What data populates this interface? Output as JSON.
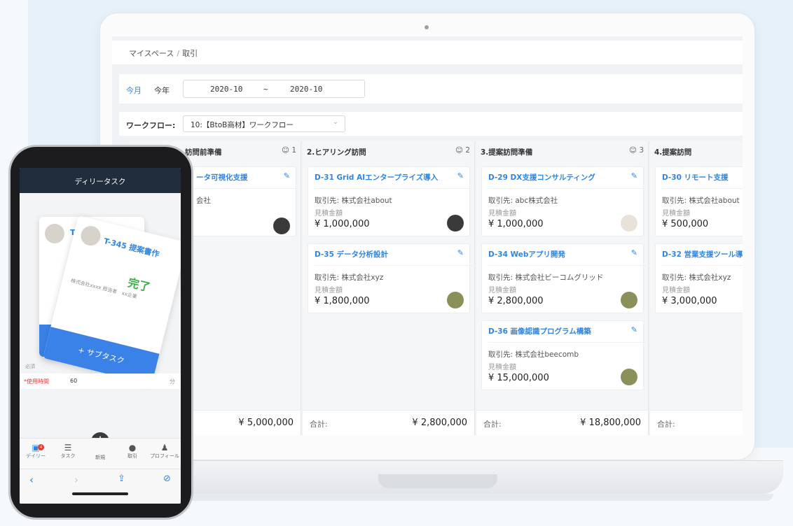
{
  "laptop": {
    "breadcrumb": {
      "root": "マイスペース",
      "separator": "/",
      "current": "取引"
    },
    "period": {
      "tab_month": "今月",
      "tab_year": "今年",
      "from": "2020-10",
      "tilde": "~",
      "to": "2020-10"
    },
    "workflow": {
      "label": "ワークフロー:",
      "selected": "10:【BtoB商材】ワークフロー"
    },
    "columns": [
      {
        "title": "訪問前準備",
        "count": "1",
        "cards": [
          {
            "title": "ータ可視化支援",
            "client": "会社",
            "amount_label": "",
            "amount": ""
          }
        ],
        "total_label": "",
        "total": "¥ 5,000,000"
      },
      {
        "title": "2.ヒアリング訪問",
        "count": "2",
        "cards": [
          {
            "title": "D-31 Grid AIエンタープライズ導入",
            "client": "取引先: 株式会社about",
            "amount_label": "見積金額",
            "amount": "¥ 1,000,000"
          },
          {
            "title": "D-35 データ分析設計",
            "client": "取引先: 株式会社xyz",
            "amount_label": "見積金額",
            "amount": "¥ 1,800,000"
          }
        ],
        "total_label": "合計:",
        "total": "¥ 2,800,000"
      },
      {
        "title": "3.提案訪問準備",
        "count": "3",
        "cards": [
          {
            "title": "D-29 DX支援コンサルティング",
            "client": "取引先: abc株式会社",
            "amount_label": "見積金額",
            "amount": "¥ 1,000,000"
          },
          {
            "title": "D-34 Webアプリ開発",
            "client": "取引先: 株式会社ビーコムグリッド",
            "amount_label": "見積金額",
            "amount": "¥ 2,800,000"
          },
          {
            "title": "D-36 画像認識プログラム構築",
            "client": "取引先: 株式会社beecomb",
            "amount_label": "見積金額",
            "amount": "¥ 15,000,000"
          }
        ],
        "total_label": "合計:",
        "total": "¥ 18,800,000"
      },
      {
        "title": "4.提案訪問",
        "count": "",
        "cards": [
          {
            "title": "D-30 リモート支援",
            "client": "取引先: 株式会社about",
            "amount_label": "見積金額",
            "amount": "¥ 500,000"
          },
          {
            "title": "D-32 営業支援ツール導",
            "client": "取引先: 株式会社xyz",
            "amount_label": "見積金額",
            "amount": "¥ 3,000,000"
          }
        ],
        "total_label": "合計:",
        "total": ""
      }
    ]
  },
  "phone": {
    "header_title": "ディリータスク",
    "card_back_id": "T-327",
    "card_front_id": "T-345 提案書作",
    "card_front_status": "完了",
    "card_front_meta": "株式会社xxxx 担当者　xx企業",
    "card_front_action": "+ サブタスク",
    "required_label": "必須",
    "time_label": "*使用時間",
    "time_value": "60",
    "time_unit": "分",
    "badge_count": "4",
    "tabs": [
      "デイリー",
      "タスク",
      "新規",
      "取引",
      "プロフィール"
    ],
    "colors": {
      "accent": "#2f86e0",
      "header": "#1f2d3d",
      "done": "#3cb043"
    }
  }
}
